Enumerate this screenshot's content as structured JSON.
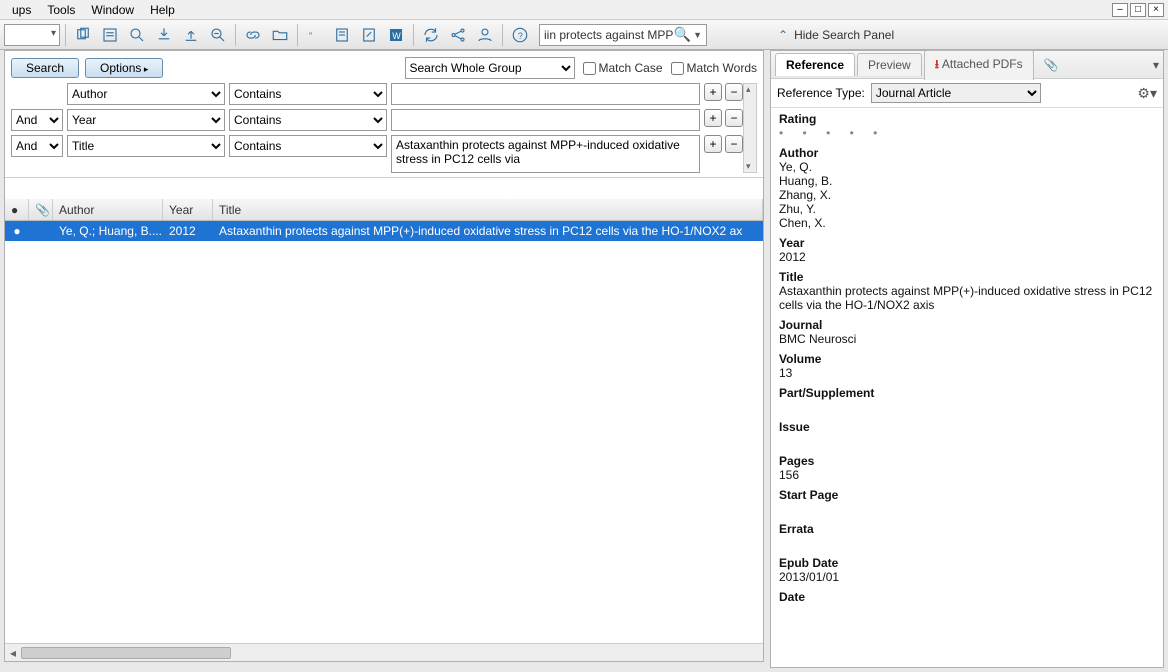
{
  "menu": {
    "items": [
      "ups",
      "Tools",
      "Window",
      "Help"
    ]
  },
  "toolbar": {
    "quicksearch_text": "iin protects against MPP+"
  },
  "hide_panel_label": "Hide Search Panel",
  "search": {
    "search_btn": "Search",
    "options_btn": "Options",
    "scope": "Search Whole Group",
    "match_case": "Match Case",
    "match_words": "Match Words",
    "rows": [
      {
        "bool": "",
        "field": "Author",
        "op": "Contains",
        "value": ""
      },
      {
        "bool": "And",
        "field": "Year",
        "op": "Contains",
        "value": ""
      },
      {
        "bool": "And",
        "field": "Title",
        "op": "Contains",
        "value": "Astaxanthin protects against MPP+-induced oxidative stress in PC12 cells via"
      }
    ]
  },
  "results": {
    "headers": {
      "author": "Author",
      "year": "Year",
      "title": "Title"
    },
    "rows": [
      {
        "author": "Ye, Q.; Huang, B....",
        "year": "2012",
        "title": "Astaxanthin protects against MPP(+)-induced oxidative stress in PC12 cells via the HO-1/NOX2 ax"
      }
    ]
  },
  "tabs": {
    "reference": "Reference",
    "preview": "Preview",
    "pdfs": "Attached PDFs"
  },
  "ref": {
    "type_label": "Reference Type:",
    "type_value": "Journal Article",
    "rating_label": "Rating",
    "author_label": "Author",
    "authors": [
      "Ye, Q.",
      "Huang, B.",
      "Zhang, X.",
      "Zhu, Y.",
      "Chen, X."
    ],
    "year_label": "Year",
    "year": "2012",
    "title_label": "Title",
    "title": "Astaxanthin protects against MPP(+)-induced oxidative stress in PC12 cells via the HO-1/NOX2 axis",
    "journal_label": "Journal",
    "journal": "BMC Neurosci",
    "volume_label": "Volume",
    "volume": "13",
    "part_label": "Part/Supplement",
    "part": "",
    "issue_label": "Issue",
    "issue": "",
    "pages_label": "Pages",
    "pages": "156",
    "startpage_label": "Start Page",
    "startpage": "",
    "errata_label": "Errata",
    "errata": "",
    "epub_label": "Epub Date",
    "epub": "2013/01/01",
    "date_label": "Date"
  }
}
